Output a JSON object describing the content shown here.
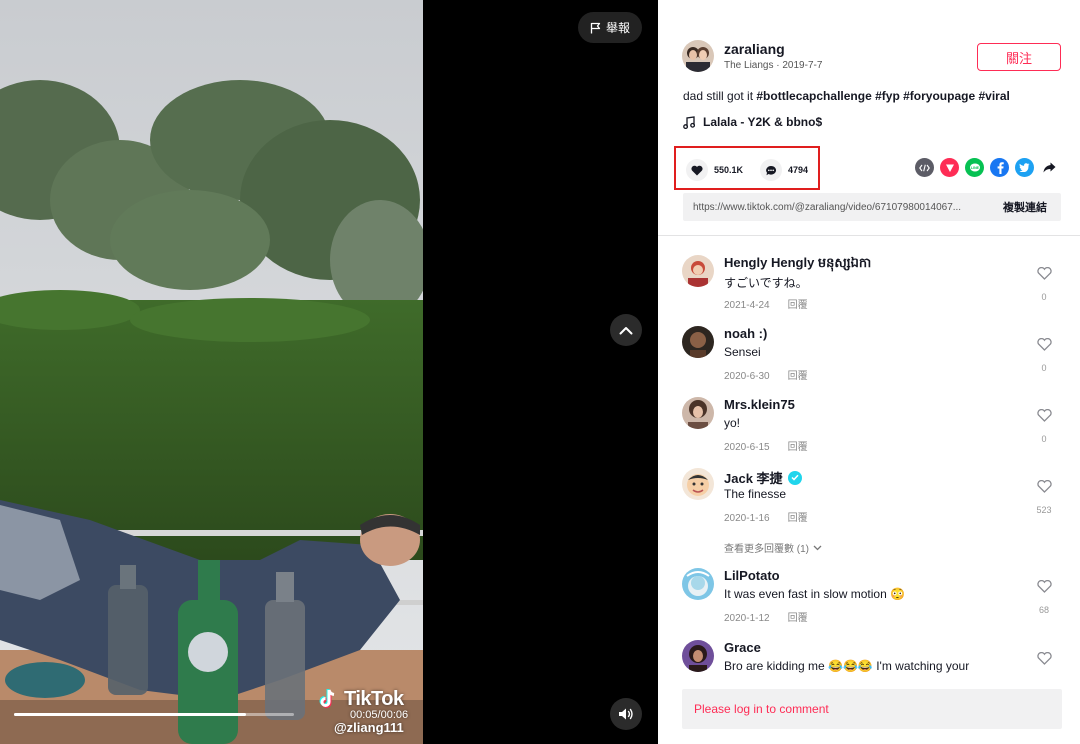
{
  "video": {
    "report_label": "舉報",
    "watermark_brand": "TikTok",
    "watermark_time": "00:05/00:06",
    "watermark_handle": "@zliang111",
    "progress": 0.83
  },
  "author": {
    "name": "zaraliang",
    "subtitle": "The Liangs · 2019-7-7",
    "follow_label": "關注"
  },
  "caption": {
    "text": "dad still got it ",
    "hashtags": [
      "#bottlecapchallenge",
      "#fyp",
      "#foryoupage",
      "#viral"
    ]
  },
  "music": {
    "title": "Lalala - Y2K & bbno$"
  },
  "stats": {
    "likes": "550.1K",
    "comments": "4794"
  },
  "share": {
    "icons": [
      "embed-icon",
      "send-icon",
      "line-icon",
      "facebook-icon",
      "twitter-icon",
      "share-arrow-icon"
    ],
    "colors": {
      "send": "#fe2c55",
      "line": "#06c152",
      "facebook": "#1877f2",
      "twitter": "#1da1f2"
    }
  },
  "link": {
    "url": "https://www.tiktok.com/@zaraliang/video/67107980014067...",
    "copy_label": "複製連結"
  },
  "comments": [
    {
      "name": "Hengly Hengly មនុស្សឯកា",
      "text": "すごいですね。",
      "date": "2021-4-24",
      "reply": "回覆",
      "likes": "0",
      "verified": false
    },
    {
      "name": "noah :)",
      "text": "Sensei",
      "date": "2020-6-30",
      "reply": "回覆",
      "likes": "0",
      "verified": false
    },
    {
      "name": "Mrs.klein75",
      "text": "yo!",
      "date": "2020-6-15",
      "reply": "回覆",
      "likes": "0",
      "verified": false
    },
    {
      "name": "Jack 李捷",
      "text": "The finesse",
      "date": "2020-1-16",
      "reply": "回覆",
      "likes": "523",
      "verified": true
    },
    {
      "name": "LilPotato",
      "text": "It was even fast in slow motion 😳",
      "date": "2020-1-12",
      "reply": "回覆",
      "likes": "68",
      "verified": false
    },
    {
      "name": "Grace",
      "text": "Bro are kidding me 😂😂😂 I'm watching your",
      "date": "",
      "reply": "",
      "likes": "",
      "verified": false
    }
  ],
  "more_replies": "查看更多回覆數 (1)",
  "login_prompt": "Please log in to comment",
  "colors": {
    "accent": "#fe2c55",
    "highlight_box": "#e01e1e"
  }
}
